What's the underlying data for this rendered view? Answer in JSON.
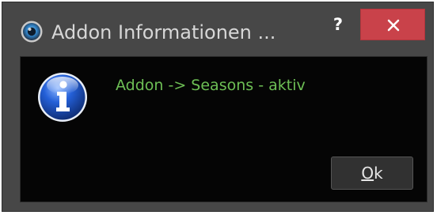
{
  "window": {
    "title": "Addon Informationen ...",
    "help_label": "?",
    "close_icon": "close-icon",
    "app_icon": "app-icon"
  },
  "dialog": {
    "icon": "info-icon",
    "message": "Addon -> Seasons - aktiv",
    "ok_button": {
      "mnemonic": "O",
      "rest": "k"
    }
  },
  "colors": {
    "titlebar_bg": "#474747",
    "content_bg": "#050505",
    "message_text": "#6dbf55",
    "close_button_bg": "#c9424a"
  }
}
